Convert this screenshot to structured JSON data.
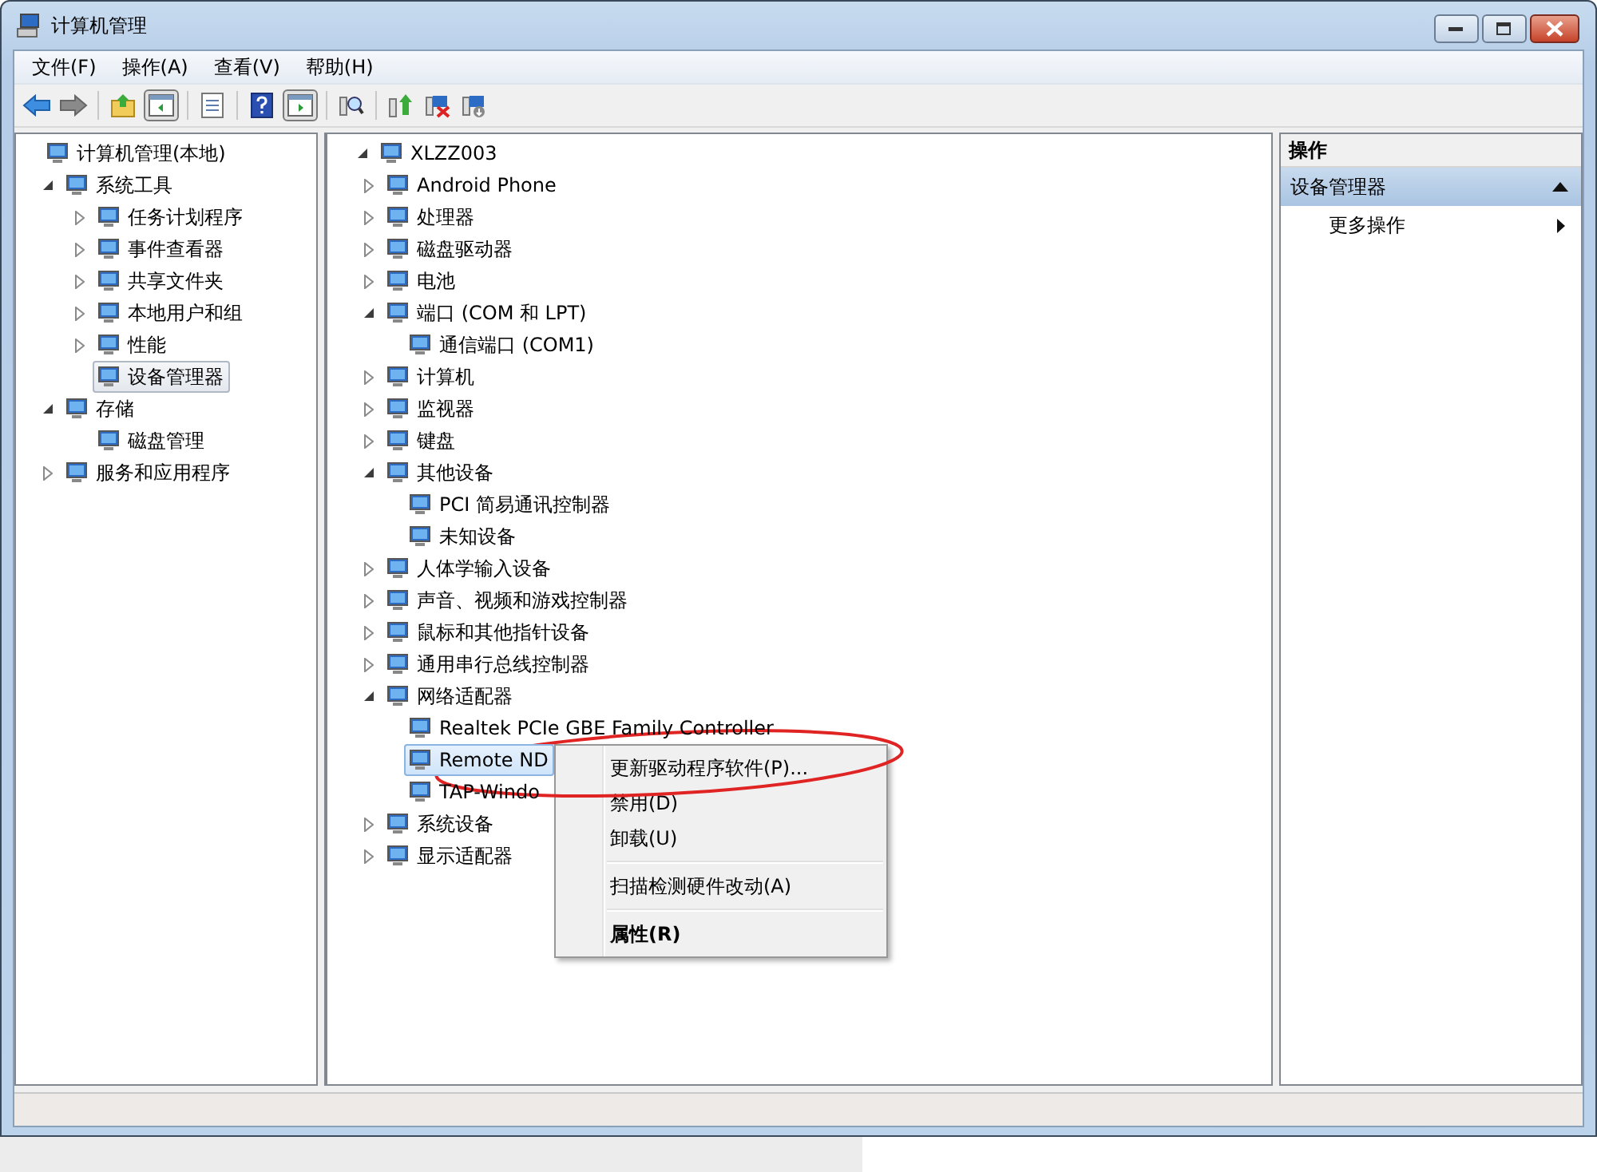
{
  "window": {
    "title": "计算机管理"
  },
  "menu_bar": [
    {
      "label": "文件(F)"
    },
    {
      "label": "操作(A)"
    },
    {
      "label": "查看(V)"
    },
    {
      "label": "帮助(H)"
    }
  ],
  "toolbar": [
    {
      "kind": "back"
    },
    {
      "kind": "forward"
    },
    {
      "kind": "separator"
    },
    {
      "kind": "up"
    },
    {
      "kind": "tree-pane",
      "pressed": true
    },
    {
      "kind": "separator"
    },
    {
      "kind": "properties"
    },
    {
      "kind": "separator"
    },
    {
      "kind": "help"
    },
    {
      "kind": "action-pane",
      "pressed": true
    },
    {
      "kind": "separator"
    },
    {
      "kind": "scan"
    },
    {
      "kind": "separator"
    },
    {
      "kind": "update"
    },
    {
      "kind": "disable"
    },
    {
      "kind": "uninstall"
    }
  ],
  "console_tree": {
    "label": "计算机管理(本地)",
    "selected": false,
    "children": [
      {
        "label": "系统工具",
        "expanded": true,
        "selected": false,
        "children": [
          {
            "label": "任务计划程序",
            "expanded": false,
            "selected": false
          },
          {
            "label": "事件查看器",
            "expanded": false,
            "selected": false
          },
          {
            "label": "共享文件夹",
            "expanded": false,
            "selected": false
          },
          {
            "label": "本地用户和组",
            "expanded": false,
            "selected": false
          },
          {
            "label": "性能",
            "expanded": false,
            "selected": false
          },
          {
            "label": "设备管理器",
            "selected": true
          }
        ]
      },
      {
        "label": "存储",
        "expanded": true,
        "selected": false,
        "children": [
          {
            "label": "磁盘管理",
            "selected": false
          }
        ]
      },
      {
        "label": "服务和应用程序",
        "expanded": false,
        "selected": false
      }
    ]
  },
  "device_tree": {
    "label": "XLZZ003",
    "expanded": true,
    "selected": false,
    "children": [
      {
        "label": "Android Phone",
        "expanded": false,
        "selected": false
      },
      {
        "label": "处理器",
        "expanded": false,
        "selected": false
      },
      {
        "label": "磁盘驱动器",
        "expanded": false,
        "selected": false
      },
      {
        "label": "电池",
        "expanded": false,
        "selected": false
      },
      {
        "label": "端口 (COM 和 LPT)",
        "expanded": true,
        "selected": false,
        "children": [
          {
            "label": "通信端口 (COM1)",
            "selected": false
          }
        ]
      },
      {
        "label": "计算机",
        "expanded": false,
        "selected": false
      },
      {
        "label": "监视器",
        "expanded": false,
        "selected": false
      },
      {
        "label": "键盘",
        "expanded": false,
        "selected": false
      },
      {
        "label": "其他设备",
        "expanded": true,
        "selected": false,
        "children": [
          {
            "label": "PCI 简易通讯控制器",
            "selected": false
          },
          {
            "label": "未知设备",
            "selected": false
          }
        ]
      },
      {
        "label": "人体学输入设备",
        "expanded": false,
        "selected": false
      },
      {
        "label": "声音、视频和游戏控制器",
        "expanded": false,
        "selected": false
      },
      {
        "label": "鼠标和其他指针设备",
        "expanded": false,
        "selected": false
      },
      {
        "label": "通用串行总线控制器",
        "expanded": false,
        "selected": false
      },
      {
        "label": "网络适配器",
        "expanded": true,
        "selected": false,
        "children": [
          {
            "label": "Realtek PCIe GBE Family Controller",
            "selected": false
          },
          {
            "label": "Remote ND",
            "selected": true
          },
          {
            "label": "TAP-Windo",
            "selected": false
          }
        ]
      },
      {
        "label": "系统设备",
        "expanded": false,
        "selected": false
      },
      {
        "label": "显示适配器",
        "expanded": false,
        "selected": false
      }
    ]
  },
  "actions_pane": {
    "header": "操作",
    "section": {
      "label": "设备管理器",
      "expanded": true
    },
    "items": [
      {
        "label": "更多操作"
      }
    ]
  },
  "context_menu": [
    {
      "kind": "item",
      "label": "更新驱动程序软件(P)...",
      "default": false
    },
    {
      "kind": "item",
      "label": "禁用(D)",
      "default": false
    },
    {
      "kind": "item",
      "label": "卸载(U)",
      "default": false
    },
    {
      "kind": "separator"
    },
    {
      "kind": "item",
      "label": "扫描检测硬件改动(A)",
      "default": false
    },
    {
      "kind": "separator"
    },
    {
      "kind": "item",
      "label": "属性(R)",
      "default": true
    }
  ]
}
